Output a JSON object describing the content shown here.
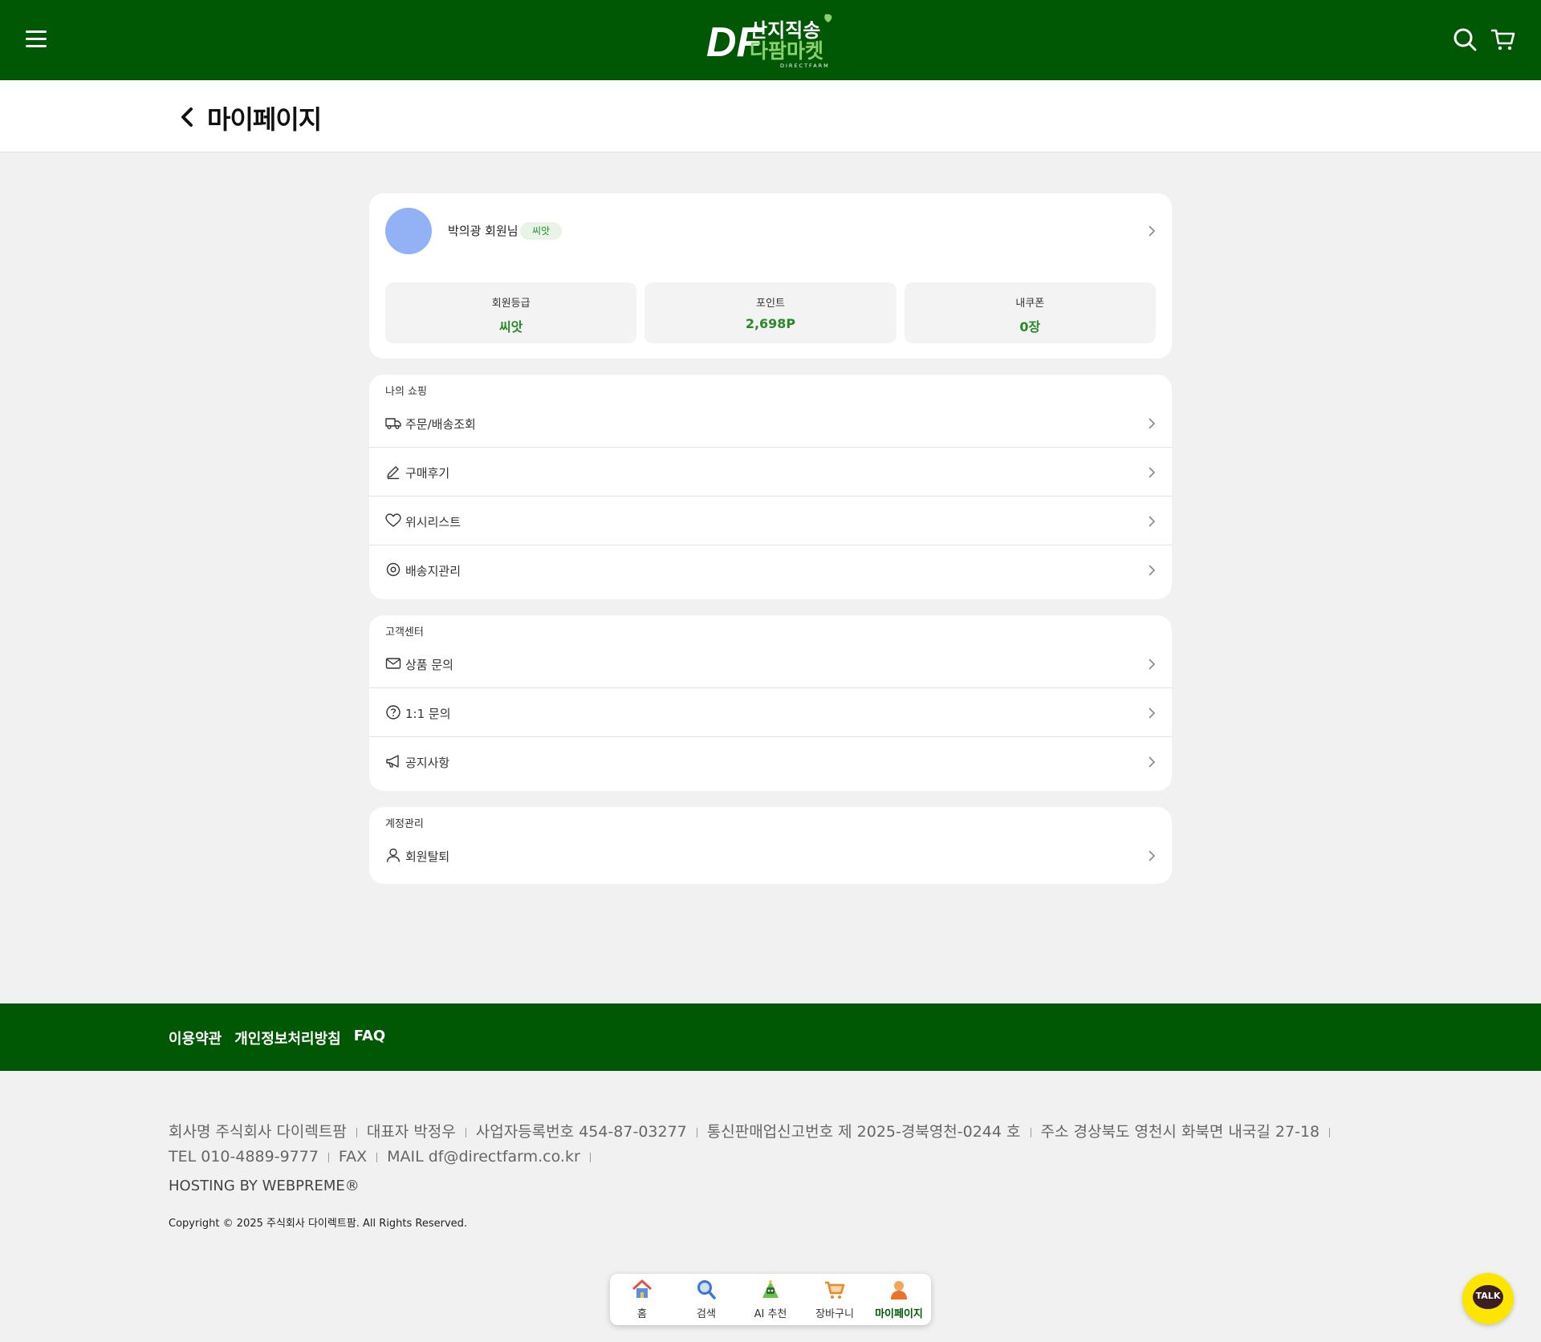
{
  "brand": {
    "name_line1": "산지직송",
    "name_line2": "다팜마켓",
    "sub": "DIRECTFARM",
    "mark": "DF"
  },
  "header": {
    "title": "마이페이지"
  },
  "profile": {
    "name": "박의광 회원님",
    "grade_badge": "씨앗",
    "stats": [
      {
        "label": "회원등급",
        "value": "씨앗"
      },
      {
        "label": "포인트",
        "value": "2,698P"
      },
      {
        "label": "내쿠폰",
        "value": "0장"
      }
    ]
  },
  "shopping": {
    "title": "나의 쇼핑",
    "items": [
      {
        "label": "주문/배송조회",
        "icon": "truck-icon"
      },
      {
        "label": "구매후기",
        "icon": "pencil-icon"
      },
      {
        "label": "위시리스트",
        "icon": "heart-icon"
      },
      {
        "label": "배송지관리",
        "icon": "location-pin-icon"
      }
    ]
  },
  "support": {
    "title": "고객센터",
    "items": [
      {
        "label": "상품 문의",
        "icon": "mail-icon"
      },
      {
        "label": "1:1 문의",
        "icon": "question-icon"
      },
      {
        "label": "공지사항",
        "icon": "megaphone-icon"
      }
    ]
  },
  "account": {
    "title": "계정관리",
    "items": [
      {
        "label": "회원탈퇴",
        "icon": "user-icon"
      }
    ]
  },
  "footer": {
    "links": [
      "이용약관",
      "개인정보처리방침",
      "FAQ"
    ],
    "company_name": "회사명 주식회사 다이렉트팜",
    "ceo": "대표자 박정우",
    "biz_no": "사업자등록번호 454-87-03277",
    "ecommerce_no": "통신판매업신고번호 제 2025-경북영천-0244 호",
    "address": "주소 경상북도 영천시 화북면 내국길 27-18",
    "tel": "TEL 010-4889-9777",
    "fax": "FAX",
    "mail": "MAIL df@directfarm.co.kr",
    "hosting": "HOSTING BY WEBPREME®",
    "copyright": "Copyright © 2025 주식회사 다이렉트팜. All Rights Reserved."
  },
  "bottom_nav": [
    {
      "label": "홈",
      "icon": "home-icon"
    },
    {
      "label": "검색",
      "icon": "search-icon"
    },
    {
      "label": "AI 추천",
      "icon": "ai-robot-icon"
    },
    {
      "label": "장바구니",
      "icon": "cart-icon"
    },
    {
      "label": "마이페이지",
      "icon": "person-icon",
      "active": true
    }
  ],
  "talk": {
    "label": "TALK"
  },
  "colors": {
    "primary": "#005805",
    "accent_green": "#2a8a2a",
    "avatar": "#93b2f5",
    "talk": "#fde500"
  }
}
